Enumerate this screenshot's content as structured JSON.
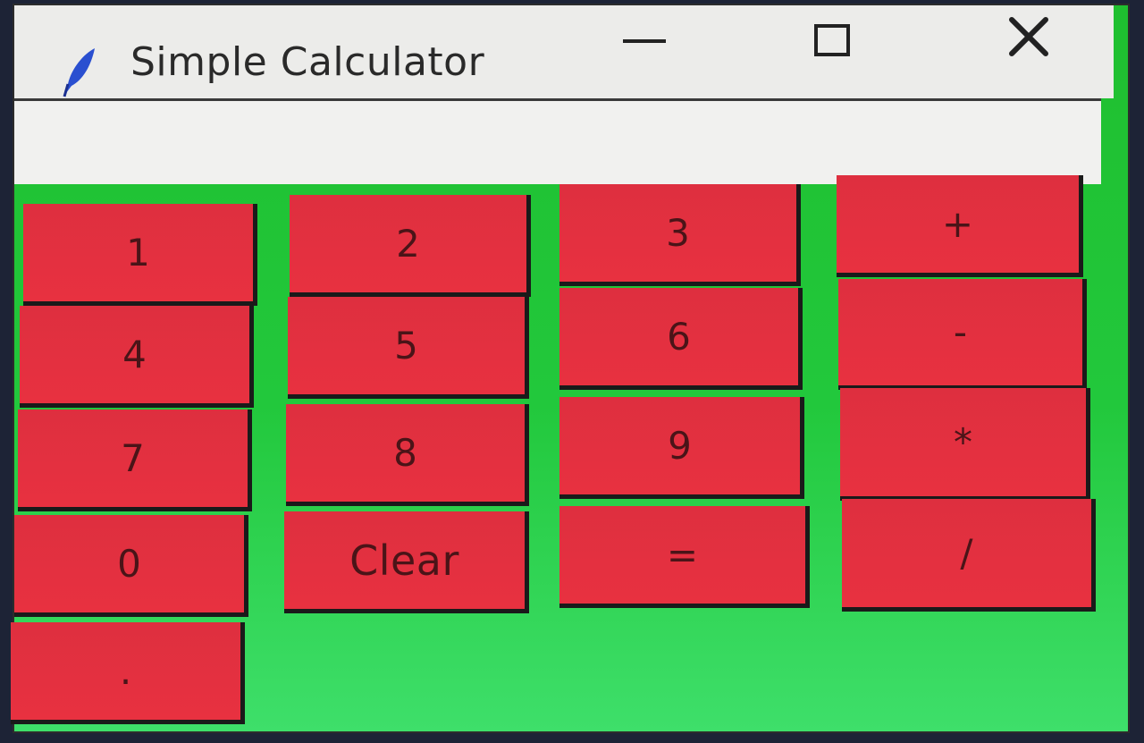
{
  "window": {
    "title": "Simple Calculator",
    "icon": "feather-icon",
    "controls": {
      "minimize_icon": "minimize-icon",
      "maximize_icon": "maximize-icon",
      "close_icon": "close-icon",
      "close_glyph": "✕"
    }
  },
  "display": {
    "value": ""
  },
  "buttons": {
    "b1": "1",
    "b2": "2",
    "b3": "3",
    "plus": "+",
    "b4": "4",
    "b5": "5",
    "b6": "6",
    "minus": "-",
    "b7": "7",
    "b8": "8",
    "b9": "9",
    "multiply": "*",
    "b0": "0",
    "clear": "Clear",
    "equals": "=",
    "divide": "/",
    "dot": "."
  },
  "colors": {
    "button_bg": "#e3303f",
    "background_green": "#22c83c",
    "titlebar": "#ececea",
    "button_text": "#4a1418",
    "icon_blue": "#2a4fd0"
  }
}
